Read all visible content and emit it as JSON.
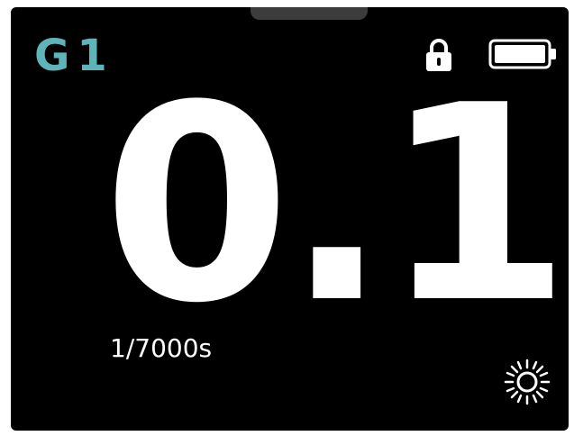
{
  "header": {
    "group_label": "G1",
    "lock_icon": "lock-icon",
    "battery_icon": "battery-icon"
  },
  "reading": {
    "value": "0.1",
    "shutter_speed": "1/7000s"
  },
  "footer": {
    "brightness_icon": "sun-icon"
  },
  "colors": {
    "accent": "#5fb4ba",
    "background": "#000000",
    "text": "#ffffff"
  }
}
